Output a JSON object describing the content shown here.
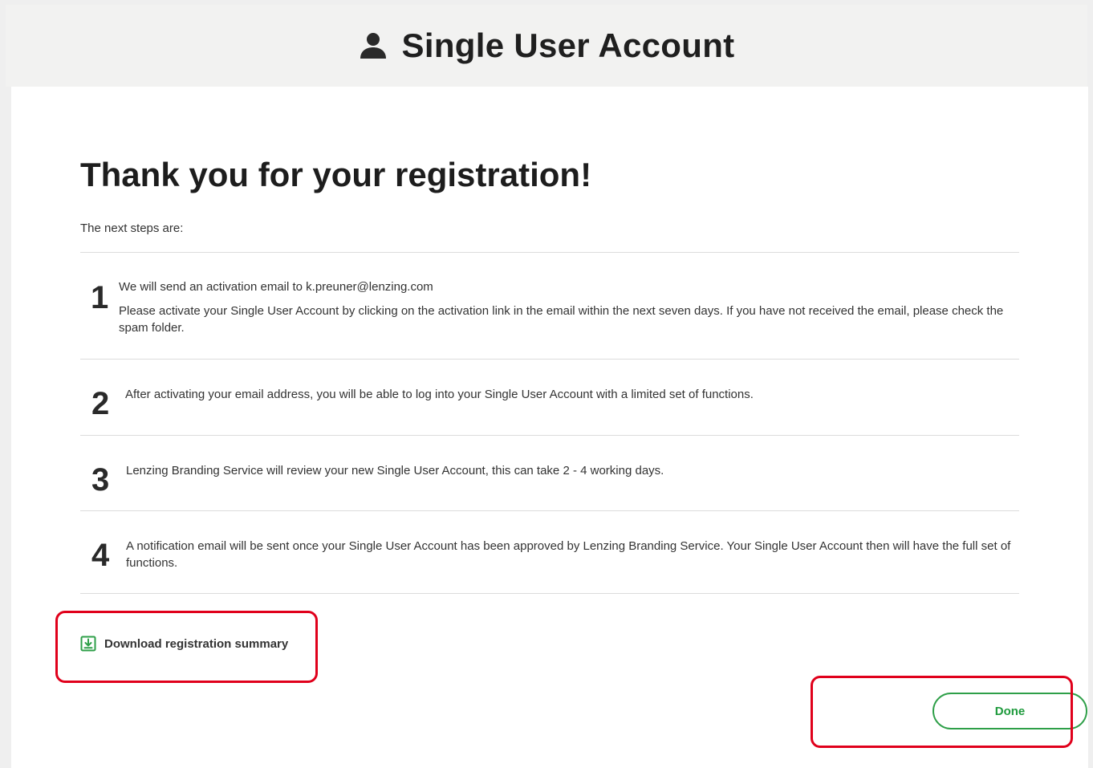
{
  "header": {
    "title": "Single User Account",
    "icon": "user-icon"
  },
  "main": {
    "heading": "Thank you for your registration!",
    "intro": "The next steps are:",
    "steps": [
      {
        "number": "1",
        "line1": "We will send an activation email to k.preuner@lenzing.com",
        "line2": "Please activate your Single User Account by clicking on the activation link in the email within the next seven days. If you have not received the email, please check the spam folder."
      },
      {
        "number": "2",
        "line1": "After activating your email address, you will be able to log into your Single User Account with a limited set of functions."
      },
      {
        "number": "3",
        "line1": "Lenzing Branding Service will review your new Single User Account, this can take 2 - 4 working days."
      },
      {
        "number": "4",
        "line1": "A notification email will be sent once your Single User Account has been approved by Lenzing Branding Service. Your Single User Account then will have the full set of functions."
      }
    ],
    "download_label": "Download registration summary",
    "done_label": "Done"
  },
  "colors": {
    "accent_green": "#2e9f48",
    "highlight_red": "#e0001b",
    "header_bg": "#f2f2f1"
  }
}
